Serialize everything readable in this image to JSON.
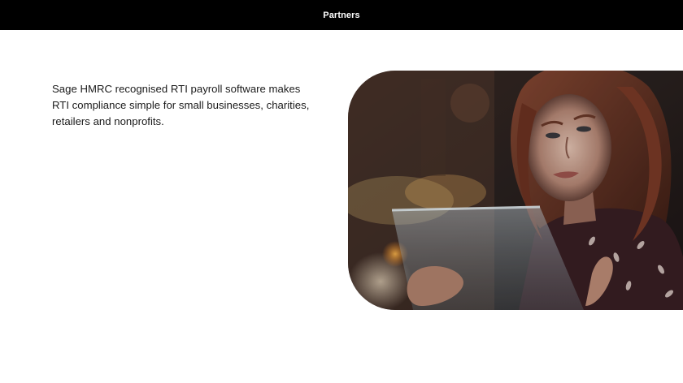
{
  "nav": {
    "partners_label": "Partners"
  },
  "intro": {
    "text": "Sage HMRC recognised RTI payroll software makes RTI compliance simple for small businesses, charities, retailers and nonprofits."
  },
  "colors": {
    "topbar_bg": "#000000",
    "topbar_text": "#ffffff",
    "body_text": "#1b1b1b",
    "page_bg": "#ffffff"
  },
  "hero_image": {
    "subject": "woman-using-tablet-at-night"
  }
}
